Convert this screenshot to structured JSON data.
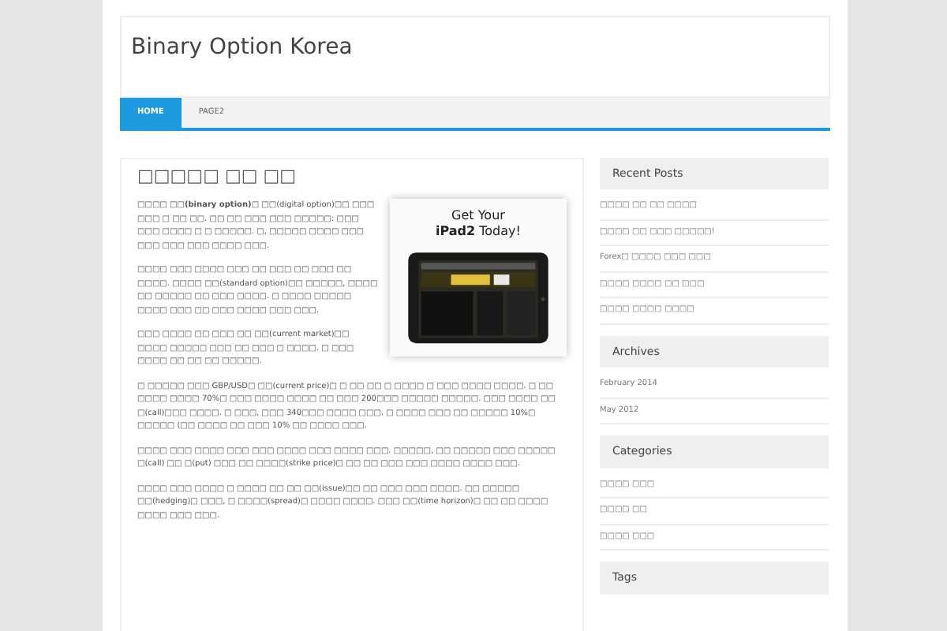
{
  "site": {
    "title": "Binary Option Korea"
  },
  "nav": [
    {
      "label": "HOME",
      "selected": true
    },
    {
      "label": "PAGE2",
      "selected": false
    }
  ],
  "article": {
    "title": "□□□□□ □□ □□",
    "ad": {
      "line1": "Get Your",
      "line2": "**iPad2** Today!"
    },
    "paragraphs": [
      "□□□□ □□**(binary option)**□ □□(digital option)□□ □□□ □□□ □ □□ □□. □□ □□ □□□ □□□ □□□□□: □□□ □□□ □□□□ □ □ □□□□□. □, □□□□□ □□□□ □□□ □□□ □□□ □□□ □□□□ □□□.",
      "□□□□ □□□ □□□□ □□□ □□ □□□ □□ □□□ □□ □□□□. □□□□ □□(standard option)□□ □□□□□, □□□□ □□ □□□□□ □□ □□□ □□□□. □ □□□□ □□□□□ □□□□ □□□ □□ □□□ □□□□ □□□ □□□.",
      "□□□ □□□□ □□ □□□ □□ □□(current market)□□ □□□□ □□□□□ □□□ □□ □□□ □ □□□□. □ □□□ □□□□ □□ □□ □□ □□□□□.",
      "□ □□□□□ □□□ GBP/USD□ □□(current price)□ □ □□ □□ □ □□□□ □ □□□ □□□□ □□□□. □ □□ □□□□ □□□□ 70%□ □□□ □□□□ □□□□ □□ □□□ 200□□□ □□□□□ □□□□□. □□□ □□□□ □□ □(call)□□□ □□□□. □ □□□, □□□ 340□□□ □□□□ □□□. □ □□□□ □□□ □□ □□□□□ 10%□ □□□□□ (□□ □□□□ □□ □□□ 10% □□ □□□□ □□□.",
      "□□□□ □□□ □□□□ □□□ □□□ □□□□ □□□ □□□□ □□□. □□□□□, □□ □□□□□ □□□ □□□□□ □(call) □□ □(put) □□□ □□ □□□□(strike price)□ □□ □□ □□□ □□□ □□□□ □□□□ □□□.",
      "□□□□ □□□ □□□□ □ □□□□ □□ □□ □□(issue)□□ □□ □□□ □□□ □□□□. □□ □□□□□ □□(hedging)□ □□□, □ □□□□(spread)□ □□□□ □□□□. □□□ □□(time horizon)□ □□ □□ □□□□ □□□□ □□□ □□□."
    ]
  },
  "sidebar": [
    {
      "title": "Recent Posts",
      "items": [
        "□□□□ □□ □□ □□□□",
        "□□□□ □□ □□□ □□□□□!",
        "Forex□ □□□□ □□□ □□□",
        "□□□□ □□□□ □□ □□□",
        "□□□□ □□□□ □□□□"
      ]
    },
    {
      "title": "Archives",
      "items": [
        "February 2014",
        "May 2012"
      ]
    },
    {
      "title": "Categories",
      "items": [
        "□□□□ □□□",
        "□□□□ □□",
        "□□□□ □□□"
      ]
    },
    {
      "title": "Tags"
    }
  ]
}
